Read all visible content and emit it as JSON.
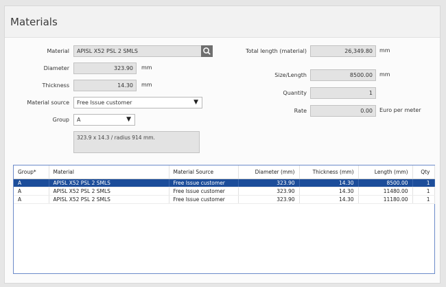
{
  "title": "Materials",
  "form": {
    "material": {
      "label": "Material",
      "value": "APISL X52 PSL 2 SMLS"
    },
    "diameter": {
      "label": "Diameter",
      "value": "323.90",
      "unit": "mm"
    },
    "thickness": {
      "label": "Thickness",
      "value": "14.30",
      "unit": "mm"
    },
    "material_source": {
      "label": "Material source",
      "value": "Free Issue customer"
    },
    "group": {
      "label": "Group",
      "value": "A"
    },
    "notes": "323.9 x 14.3 / radius 914 mm.",
    "total_length": {
      "label": "Total length (material)",
      "value": "26,349.80",
      "unit": "mm"
    },
    "size_length": {
      "label": "Size/Length",
      "value": "8500.00",
      "unit": "mm"
    },
    "quantity": {
      "label": "Quantity",
      "value": "1"
    },
    "rate": {
      "label": "Rate",
      "value": "0.00",
      "unit": "Euro per meter"
    }
  },
  "icons": {
    "search": "search-icon",
    "dropdown": "caret-down-icon"
  },
  "colors": {
    "selection": "#1c4d9a",
    "grid_border": "#6b8ac9"
  },
  "table": {
    "columns": [
      "Group*",
      "Material",
      "Material Source",
      "Diameter (mm)",
      "Thickness (mm)",
      "Length (mm)",
      "Qty"
    ],
    "rows": [
      [
        "A",
        "APISL X52 PSL 2 SMLS",
        "Free Issue customer",
        "323.90",
        "14.30",
        "8500.00",
        "1"
      ],
      [
        "A",
        "APISL X52 PSL 2 SMLS",
        "Free Issue customer",
        "323.90",
        "14.30",
        "11480.00",
        "1"
      ],
      [
        "A",
        "APISL X52 PSL 2 SMLS",
        "Free Issue customer",
        "323.90",
        "14.30",
        "11180.00",
        "1"
      ]
    ],
    "selected_row": 0
  }
}
